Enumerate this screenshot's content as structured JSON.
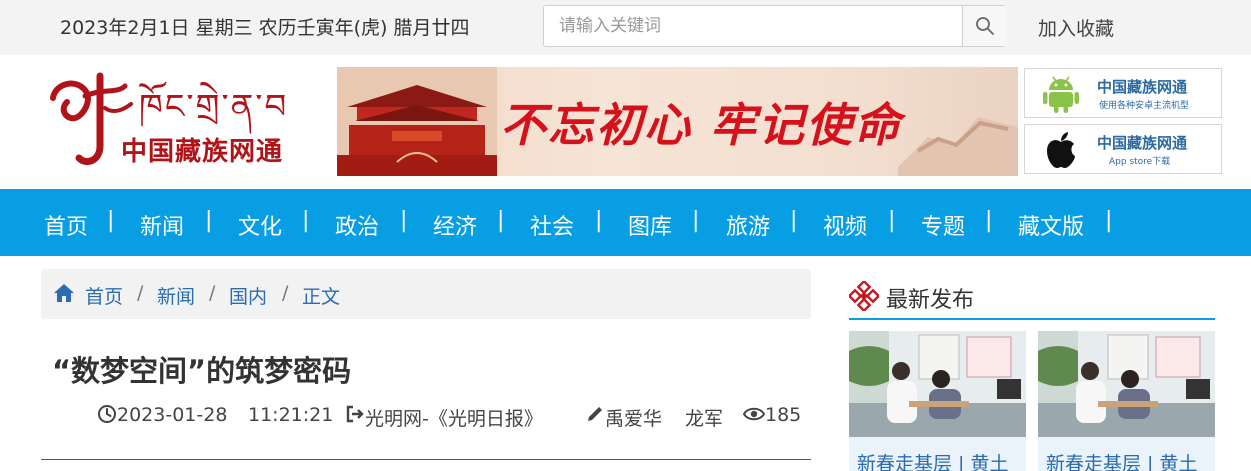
{
  "topbar": {
    "date_text": "2023年2月1日 星期三 农历壬寅年(虎) 腊月廿四",
    "search_placeholder": "请输入关键词",
    "favorite_label": "加入收藏"
  },
  "header": {
    "logo_tibetan": "ཁོང་གྲེ་ན་བ",
    "logo_chinese": "中国藏族网通",
    "banner_slogan": "不忘初心 牢记使命",
    "apps": [
      {
        "name": "中国藏族网通",
        "subtitle": "使用各种安卓主流机型",
        "icon": "android-icon"
      },
      {
        "name": "中国藏族网通",
        "subtitle": "App store下载",
        "icon": "apple-icon"
      }
    ]
  },
  "nav": {
    "items": [
      "首页",
      "新闻",
      "文化",
      "政治",
      "经济",
      "社会",
      "图库",
      "旅游",
      "视频",
      "专题",
      "藏文版"
    ],
    "separator": "|"
  },
  "breadcrumb": {
    "items": [
      "首页",
      "新闻",
      "国内",
      "正文"
    ],
    "separator": "/"
  },
  "article": {
    "title": "“数梦空间”的筑梦密码",
    "date": "2023-01-28",
    "time": "11:21:21",
    "source": "光明网-《光明日报》",
    "authors": "禹爱华",
    "editor": "龙军",
    "views": "185"
  },
  "sidebar": {
    "heading": "最新发布",
    "cards": [
      {
        "caption": "新春走基层 | 黄土"
      },
      {
        "caption": "新春走基层 | 黄土"
      }
    ]
  },
  "colors": {
    "nav_blue": "#079ee4",
    "link_blue": "#2b6cb0",
    "brand_red": "#b0141a"
  }
}
